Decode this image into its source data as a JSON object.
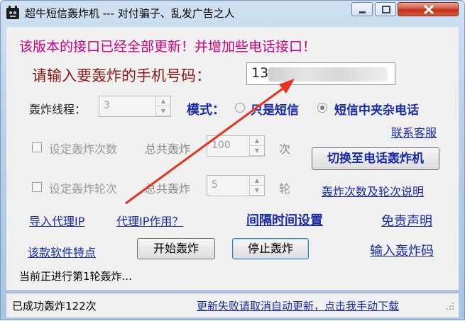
{
  "window": {
    "title": "超牛短信轰炸机 --- 对付骗子、乱发广告之人"
  },
  "notice": "该版本的接口已经全部更新！并增加些电话接口！",
  "phone": {
    "label": "请输入要轰炸的手机号码：",
    "value": "13"
  },
  "threads": {
    "label": "轰炸线程：",
    "value": "3"
  },
  "mode": {
    "label": "模式：",
    "options": [
      "只是短信",
      "短信中夹杂电话"
    ],
    "selected": "短信中夹杂电话"
  },
  "links": {
    "support": "联系客服",
    "count_help": "轰炸次数及轮次说明",
    "import_proxy": "导入代理IP",
    "proxy_help": "代理IP作用？",
    "interval": "间隔时间设置",
    "disclaimer": "免责声明",
    "features": "该款软件特点",
    "input_code": "输入轰炸码"
  },
  "count_row": {
    "checkbox_label": "设定轰炸次数",
    "total_label": "总共轰炸",
    "value": "100",
    "unit": "次"
  },
  "round_row": {
    "checkbox_label": "设定轰炸轮次",
    "total_label": "总共轰炸",
    "value": "5",
    "unit": "轮"
  },
  "buttons": {
    "switch": "切换至电话轰炸机",
    "start": "开始轰炸",
    "stop": "停止轰炸"
  },
  "progress_text": "当前正进行第1轮轰炸...",
  "statusbar": {
    "left": "已成功轰炸122次",
    "right": "更新失败请取消自动更新，点击我手动下载"
  },
  "colors": {
    "notice": "#d1007a",
    "prompt": "#8b1a1a",
    "accent": "#1a2aa6",
    "arrow": "#e8321e"
  }
}
